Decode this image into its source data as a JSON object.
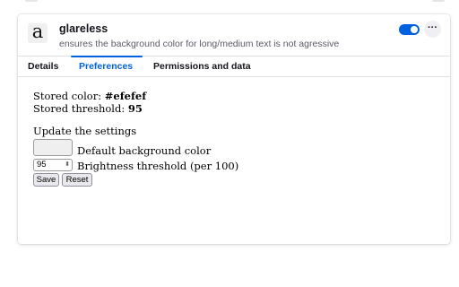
{
  "extension": {
    "icon_letter": "a",
    "name": "glareless",
    "description": "ensures the background color for long/medium text is not agressive",
    "enabled": true,
    "more_label": "···"
  },
  "tabs": [
    {
      "label": "Details",
      "active": false
    },
    {
      "label": "Preferences",
      "active": true
    },
    {
      "label": "Permissions and data",
      "active": false
    }
  ],
  "options": {
    "stored_color_label": "Stored color:",
    "stored_color_value": "#efefef",
    "stored_threshold_label": "Stored threshold:",
    "stored_threshold_value": "95",
    "update_heading": "Update the settings",
    "color_input_label": "Default background color",
    "color_input_value": "#efefef",
    "threshold_input_value": "95",
    "threshold_input_label": "Brightness threshold (per 100)",
    "save_label": "Save",
    "reset_label": "Reset"
  },
  "colors": {
    "accent": "#0061e0"
  }
}
